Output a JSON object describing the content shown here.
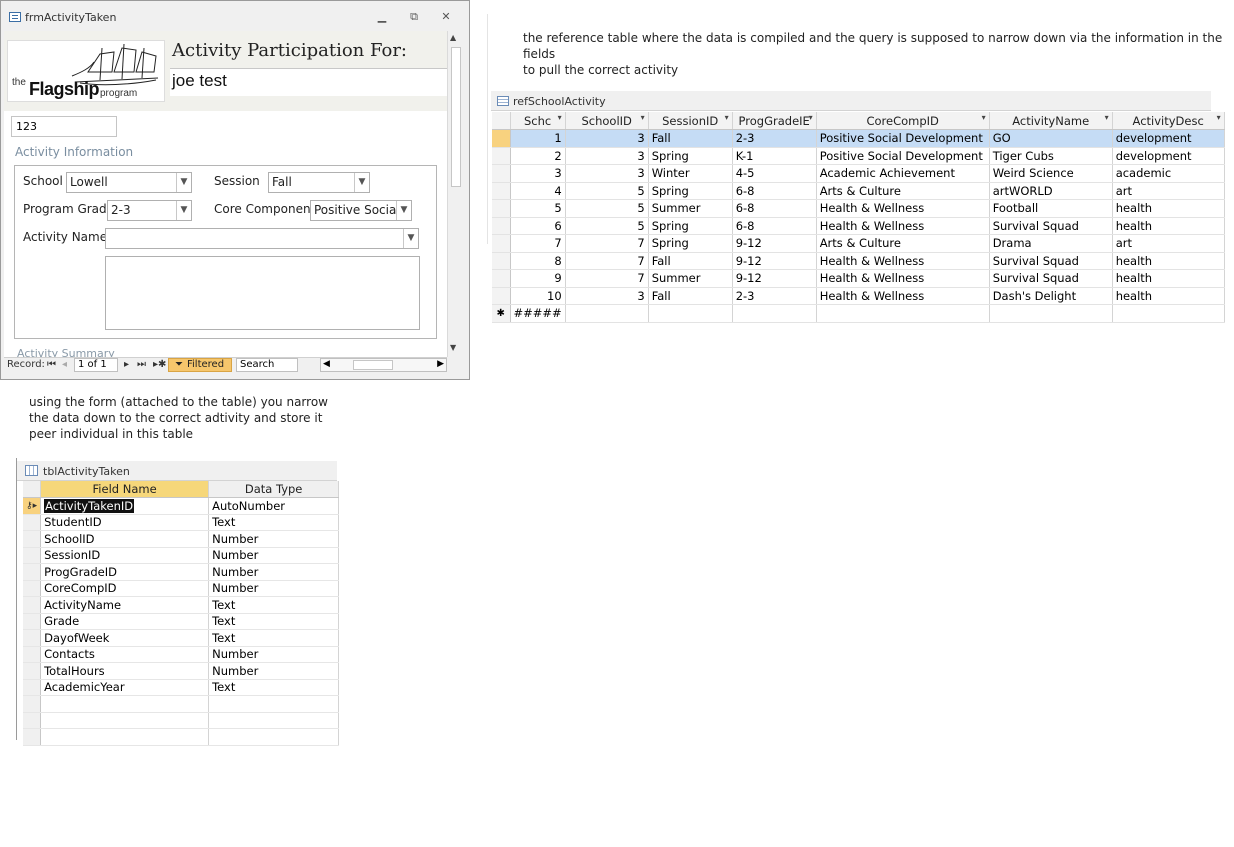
{
  "form": {
    "window_title": "frmActivityTaken",
    "logo": {
      "the": "the",
      "flagship": "Flagship",
      "program": "program"
    },
    "heading": "Activity Participation For:",
    "student_name": "joe test",
    "student_id": "123",
    "section_label": "Activity Information",
    "fields": {
      "school_label": "School",
      "school_value": "Lowell",
      "session_label": "Session",
      "session_value": "Fall",
      "program_grade_label": "Program Grade",
      "program_grade_value": "2-3",
      "core_component_label": "Core Component",
      "core_component_value": "Positive Social D",
      "activity_name_label": "Activity Name",
      "activity_name_value": ""
    },
    "summary_label": "Activity Summary",
    "nav": {
      "record_label": "Record:",
      "position": "1 of 1",
      "filtered": "Filtered",
      "search": "Search"
    }
  },
  "annotations": {
    "reference_note_line1": "the reference table where the data is compiled and the query is supposed to narrow down via the information in the fields",
    "reference_note_line2": "to pull the correct activity",
    "form_note_line1": "using the form (attached to the table) you narrow",
    "form_note_line2": "the data down to the correct adtivity and store it",
    "form_note_line3": "peer individual in this table"
  },
  "ref_table": {
    "caption": "refSchoolActivity",
    "columns": [
      "Schc",
      "SchoolID",
      "SessionID",
      "ProgGradeIE",
      "CoreCompID",
      "ActivityName",
      "ActivityDesc"
    ],
    "rows": [
      [
        "1",
        "3",
        "Fall",
        "2-3",
        "Positive Social Development",
        "GO",
        "development"
      ],
      [
        "2",
        "3",
        "Spring",
        "K-1",
        "Positive Social Development",
        "Tiger Cubs",
        "development"
      ],
      [
        "3",
        "3",
        "Winter",
        "4-5",
        "Academic Achievement",
        "Weird Science",
        "academic"
      ],
      [
        "4",
        "5",
        "Spring",
        "6-8",
        "Arts & Culture",
        "artWORLD",
        "art"
      ],
      [
        "5",
        "5",
        "Summer",
        "6-8",
        "Health & Wellness",
        "Football",
        "health"
      ],
      [
        "6",
        "5",
        "Spring",
        "6-8",
        "Health & Wellness",
        "Survival Squad",
        "health"
      ],
      [
        "7",
        "7",
        "Spring",
        "9-12",
        "Arts & Culture",
        "Drama",
        "art"
      ],
      [
        "8",
        "7",
        "Fall",
        "9-12",
        "Health & Wellness",
        "Survival Squad",
        "health"
      ],
      [
        "9",
        "7",
        "Summer",
        "9-12",
        "Health & Wellness",
        "Survival Squad",
        "health"
      ],
      [
        "10",
        "3",
        "Fall",
        "2-3",
        "Health & Wellness",
        "Dash's Delight",
        "health"
      ]
    ],
    "new_row_marker": "✱",
    "new_row_value": "#####"
  },
  "design_table": {
    "caption": "tblActivityTaken",
    "columns": [
      "Field Name",
      "Data Type"
    ],
    "rows": [
      [
        "ActivityTakenID",
        "AutoNumber"
      ],
      [
        "StudentID",
        "Text"
      ],
      [
        "SchoolID",
        "Number"
      ],
      [
        "SessionID",
        "Number"
      ],
      [
        "ProgGradeID",
        "Number"
      ],
      [
        "CoreCompID",
        "Number"
      ],
      [
        "ActivityName",
        "Text"
      ],
      [
        "Grade",
        "Text"
      ],
      [
        "DayofWeek",
        "Text"
      ],
      [
        "Contacts",
        "Number"
      ],
      [
        "TotalHours",
        "Number"
      ],
      [
        "AcademicYear",
        "Text"
      ]
    ]
  }
}
